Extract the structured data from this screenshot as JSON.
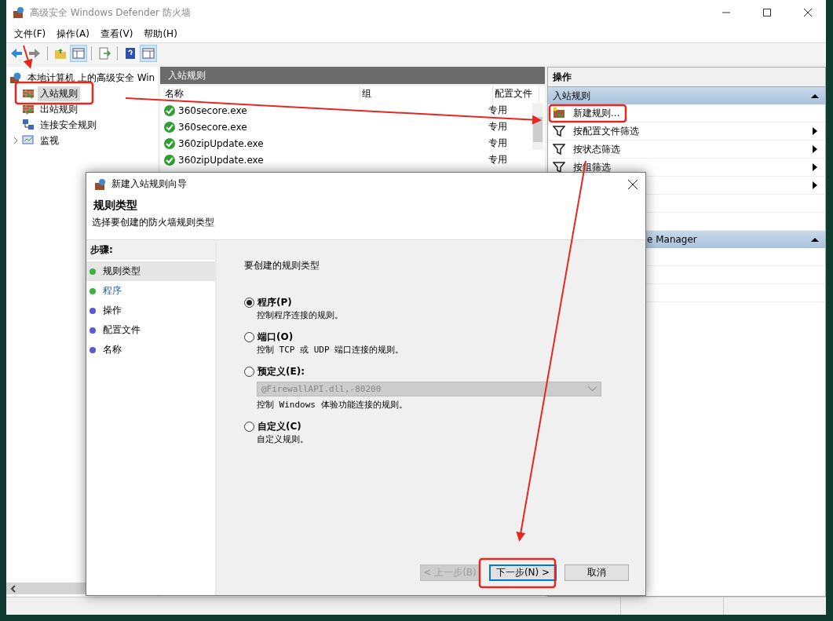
{
  "window": {
    "title": "高级安全 Windows Defender 防火墙"
  },
  "menu": [
    "文件(F)",
    "操作(A)",
    "查看(V)",
    "帮助(H)"
  ],
  "tree": {
    "root": "本地计算机 上的高级安全 Win",
    "children": [
      {
        "label": "入站规则",
        "selected": true,
        "kind": "inbound"
      },
      {
        "label": "出站规则",
        "selected": false,
        "kind": "outbound"
      },
      {
        "label": "连接安全规则",
        "selected": false,
        "kind": "connection"
      },
      {
        "label": "监视",
        "selected": false,
        "kind": "monitor"
      }
    ]
  },
  "rules": {
    "title": "入站规则",
    "columns": [
      "名称",
      "组",
      "配置文件"
    ],
    "rows": [
      {
        "name": "360secore.exe",
        "profile": "专用",
        "enabled": true
      },
      {
        "name": "360secore.exe",
        "profile": "专用",
        "enabled": true
      },
      {
        "name": "360zipUpdate.exe",
        "profile": "专用",
        "enabled": true
      },
      {
        "name": "360zipUpdate.exe",
        "profile": "专用",
        "enabled": true
      }
    ]
  },
  "actions": {
    "title": "操作",
    "sections": [
      {
        "title": "入站规则",
        "items": [
          {
            "label": "新建规则...",
            "kind": "new"
          },
          {
            "label": "按配置文件筛选",
            "kind": "filter"
          },
          {
            "label": "按状态筛选",
            "kind": "filter"
          },
          {
            "label": "按组筛选",
            "kind": "filter"
          },
          {
            "kind": "submenu"
          },
          {
            "kind": "plain"
          },
          {
            "kind": "plain"
          }
        ]
      },
      {
        "title": "e Manager",
        "items": [
          {
            "kind": "plain"
          },
          {
            "kind": "plain"
          },
          {
            "kind": "plain"
          }
        ]
      }
    ]
  },
  "dialog": {
    "title": "新建入站规则向导",
    "heading": "规则类型",
    "subtitle": "选择要创建的防火墙规则类型",
    "steps_title": "步骤:",
    "steps": [
      {
        "label": "规则类型",
        "selected": true,
        "highlighted": false,
        "color": "#3cb043"
      },
      {
        "label": "程序",
        "selected": false,
        "highlighted": true,
        "color": "#3cb043"
      },
      {
        "label": "操作",
        "selected": false,
        "highlighted": false,
        "color": "#5a5ad0"
      },
      {
        "label": "配置文件",
        "selected": false,
        "highlighted": false,
        "color": "#5a5ad0"
      },
      {
        "label": "名称",
        "selected": false,
        "highlighted": false,
        "color": "#5a5ad0"
      }
    ],
    "prompt": "要创建的规则类型",
    "options": [
      {
        "label": "程序(P)",
        "description": "控制程序连接的规则。",
        "selected": true
      },
      {
        "label": "端口(O)",
        "description": "控制 TCP 或 UDP 端口连接的规则。",
        "selected": false
      },
      {
        "label": "预定义(E):",
        "description": "控制 Windows 体验功能连接的规则。",
        "selected": false,
        "dropdown": "@FirewallAPI.dll,-80200"
      },
      {
        "label": "自定义(C)",
        "description": "自定义规则。",
        "selected": false
      }
    ],
    "buttons": [
      {
        "label": "< 上一步(B)",
        "disabled": true,
        "default": false
      },
      {
        "label": "下一步(N) >",
        "disabled": false,
        "default": true
      },
      {
        "label": "取消",
        "disabled": false,
        "default": false
      }
    ]
  }
}
